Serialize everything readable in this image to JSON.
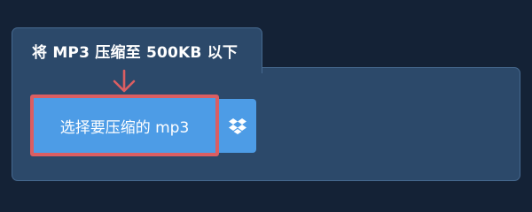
{
  "tab": {
    "title": "将 MP3 压缩至 500KB 以下"
  },
  "upload": {
    "choose_label": "选择要压缩的 mp3",
    "dropbox_icon": "dropbox-icon",
    "arrow_icon": "arrow-down-icon"
  },
  "colors": {
    "background": "#142236",
    "panel": "#2c496a",
    "button": "#4d9ce6",
    "highlight": "#db5e62"
  }
}
